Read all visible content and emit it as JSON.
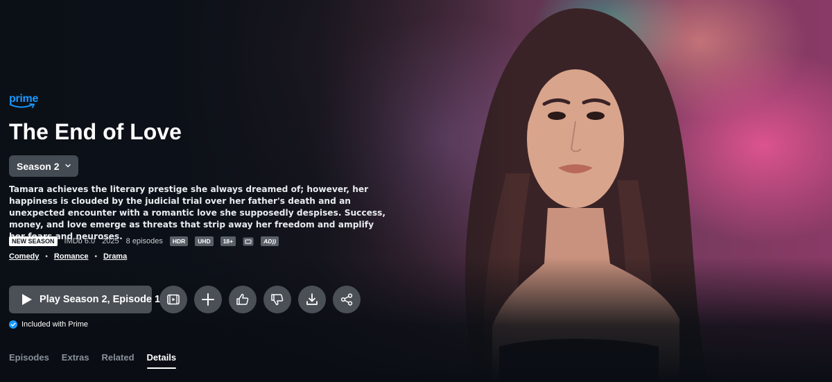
{
  "brand": {
    "logo_text": "prime",
    "accent": "#1a98ff"
  },
  "title": "The End of Love",
  "season_selector": {
    "value": "Season 2",
    "icon": "chevron-down-icon"
  },
  "synopsis": "Tamara achieves the literary prestige she always dreamed of; however, her happiness is clouded by the judicial trial over her father's death and an unexpected encounter with a romantic love she supposedly despises. Success, money, and love emerge as threats that strip away her freedom and amplify her fears and neuroses.",
  "meta": {
    "new_badge": "NEW SEASON",
    "imdb": "IMDb 6.0",
    "year": "2025",
    "episodes": "8 episodes",
    "hdr": "HDR",
    "uhd": "UHD",
    "rating": "18+",
    "subtitles_icon": "subtitles-icon",
    "ad_badge": "AD"
  },
  "genres": [
    "Comedy",
    "Romance",
    "Drama"
  ],
  "actions": {
    "play_label": "Play Season 2, Episode 1",
    "buttons": [
      "trailer-icon",
      "plus-icon",
      "thumbs-up-icon",
      "thumbs-down-icon",
      "download-icon",
      "share-icon"
    ]
  },
  "included": {
    "text": "Included with Prime",
    "icon": "check-circle-icon"
  },
  "tabs": [
    {
      "label": "Episodes",
      "active": false
    },
    {
      "label": "Extras",
      "active": false
    },
    {
      "label": "Related",
      "active": false
    },
    {
      "label": "Details",
      "active": true
    }
  ]
}
